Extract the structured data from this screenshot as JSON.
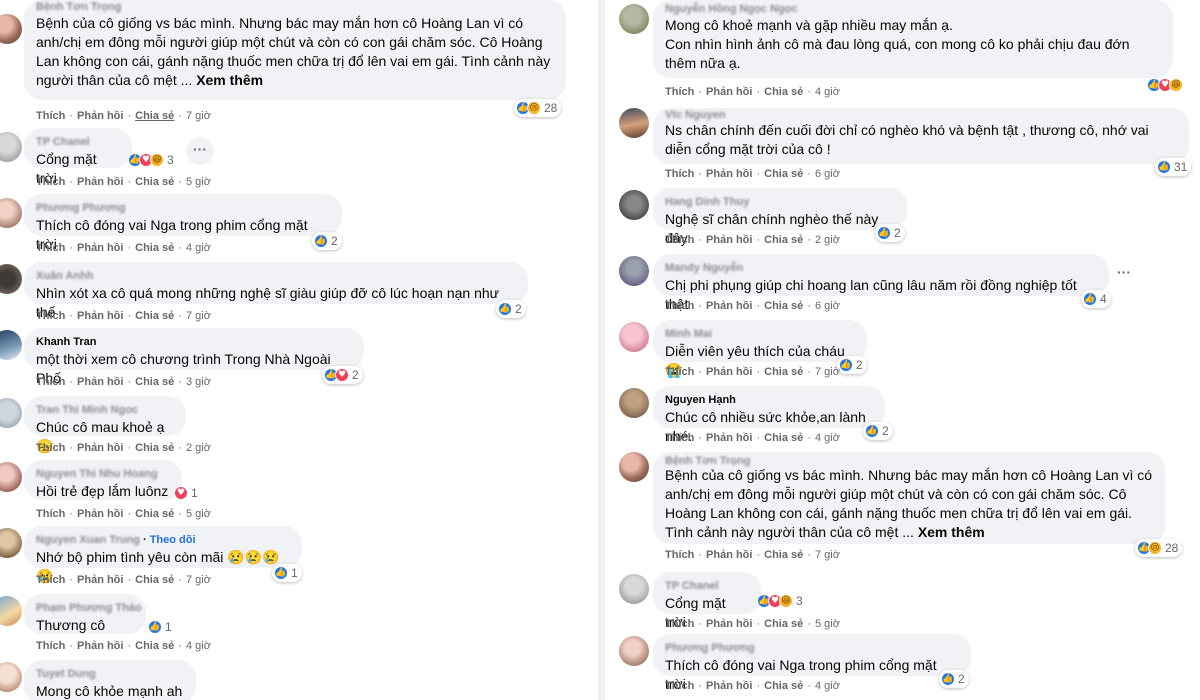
{
  "left": {
    "comments": [
      {
        "author": "Bệnh Tơn Trọng",
        "text": "Bệnh của cô giống vs bác mình. Nhưng bác may mắn hơn cô Hoàng Lan vì có anh/chị em đông mỗi người giúp một chút và còn có con gái chăm sóc. Cô Hoàng Lan không con cái, gánh nặng thuốc men chữa trị đổ lên vai em gái. Tình cảnh này người thân của cô mệt ...",
        "see_more": "Xem thêm",
        "reaction_count": "28",
        "time": "7 giờ"
      },
      {
        "author": "TP Chanel",
        "text": "Cổng mặt trời",
        "reaction_count": "3",
        "time": "5 giờ"
      },
      {
        "author": "Phương Phương",
        "text": "Thích cô đóng vai Nga trong phim cổng mặt trời",
        "reaction_count": "2",
        "time": "4 giờ"
      },
      {
        "author": "Xuân Anhh",
        "text": "Nhìn xót xa cô quá mong những nghệ sĩ giàu giúp đỡ cô lúc hoạn nạn như thế",
        "reaction_count": "2",
        "time": "7 giờ"
      },
      {
        "author": "Khanh Tran",
        "text": "một thời xem cô chương trình Trong Nhà Ngoài Phố",
        "reaction_count": "2",
        "time": "3 giờ"
      },
      {
        "author": "Tran Thi Minh Ngoc",
        "text": "Chúc cô mau khoẻ ạ😞",
        "reaction_count": "",
        "time": "2 giờ"
      },
      {
        "author": "Nguyen Thi Nhu Hoang",
        "text": "Hồi trẻ đẹp lắm luônz",
        "reaction_count": "1",
        "time": "5 giờ"
      },
      {
        "author": "Nguyen Xuan Trung",
        "follow": "Theo dõi",
        "text": "Nhớ bộ phim tình yêu còn mãi 😢😢😢😢",
        "reaction_count": "1",
        "time": "7 giờ"
      },
      {
        "author": "Phạm Phương Thảo",
        "text": "Thương cô",
        "reaction_count": "1",
        "time": "4 giờ"
      },
      {
        "author": "Tuyet Dung",
        "text": "Mong cô khỏe mạnh ah",
        "reaction_count": "",
        "time": ""
      }
    ]
  },
  "right": {
    "comments": [
      {
        "author": "Nguyễn Hồng Ngọc Ngọc",
        "text": "Mong cô khoẻ mạnh và gặp nhiều may mắn ạ.\nCon nhìn hình ảnh cô mà đau lòng quá, con mong cô ko phải chịu đau đớn thêm nữa ạ.",
        "reaction_count": "",
        "time": "4 giờ"
      },
      {
        "author": "Vtc Nguyen",
        "text": "Ns chân chính đến cuối đời chỉ có nghèo khó và bệnh tật , thương cô, nhớ vai diễn cổng mặt trời của cô !",
        "reaction_count": "31",
        "time": "6 giờ"
      },
      {
        "author": "Hang Dinh Thuy",
        "text": "Nghệ sĩ chân chính nghèo thế này đây",
        "reaction_count": "2",
        "time": "2 giờ"
      },
      {
        "author": "Mandy Nguyễn",
        "text": "Chị phi phụng giúp chi hoang lan cũng lâu năm rồi đồng nghiệp tốt thật",
        "reaction_count": "4",
        "time": "6 giờ"
      },
      {
        "author": "Minh Mai",
        "text": "Diễn viên yêu thích của cháu 😭",
        "reaction_count": "2",
        "time": "7 giờ"
      },
      {
        "author": "Nguyen Hạnh",
        "text": "Chúc cô nhiều sức khỏe,an lành nhé.",
        "reaction_count": "2",
        "time": "4 giờ"
      },
      {
        "author": "Bệnh Tơn Trọng",
        "text": "Bệnh của cô giống vs bác mình. Nhưng bác may mắn hơn cô Hoàng Lan vì có anh/chị em đông mỗi người giúp một chút và còn có con gái chăm sóc. Cô Hoàng Lan không con cái, gánh nặng thuốc men chữa trị đổ lên vai em gái. Tình cảnh này người thân của cô mệt ...",
        "see_more": "Xem thêm",
        "reaction_count": "28",
        "time": "7 giờ"
      },
      {
        "author": "TP Chanel",
        "text": "Cổng mặt trời",
        "reaction_count": "3",
        "time": "5 giờ"
      },
      {
        "author": "Phương Phương",
        "text": "Thích cô đóng vai Nga trong phim cổng mặt trời",
        "reaction_count": "2",
        "time": "4 giờ"
      }
    ]
  },
  "actions": {
    "like": "Thích",
    "reply": "Phản hồi",
    "share": "Chia sẻ"
  },
  "icons": {
    "like": "like-icon",
    "love": "love-icon",
    "sad": "sad-icon",
    "haha": "haha-icon",
    "more": "more-options-icon"
  },
  "colors": {
    "bubble": "#f0f2f5",
    "like_blue": "#1877f2",
    "love_red": "#f33e58",
    "emoji_yellow": "#f7b125",
    "meta_gray": "#65676b"
  }
}
